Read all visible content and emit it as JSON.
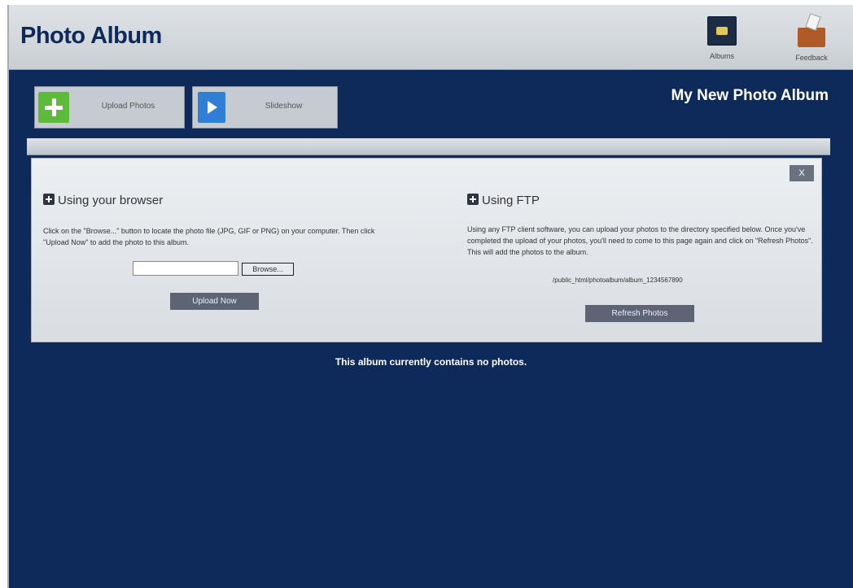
{
  "header": {
    "title": "Photo Album",
    "albums_label": "Albums",
    "feedback_label": "Feedback"
  },
  "toolbar": {
    "upload_label": "Upload Photos",
    "slideshow_label": "Slideshow"
  },
  "album_title": "My New Photo Album",
  "upload_panel": {
    "close_label": "X",
    "browser": {
      "heading": "Using your browser",
      "instructions": "Click on the \"Browse...\" button to locate the photo file (JPG, GIF or PNG) on your computer. Then click \"Upload Now\" to add the photo to this album.",
      "file_value": "",
      "browse_label": "Browse...",
      "upload_now_label": "Upload Now"
    },
    "ftp": {
      "heading": "Using FTP",
      "instructions": "Using any FTP client software, you can upload your photos to the directory specified below. Once you've completed the upload of your photos, you'll need to come to this page again and click on \"Refresh Photos\". This will add the photos to the album.",
      "path": "/public_html/photoalbum/album_1234567890",
      "refresh_label": "Refresh Photos"
    }
  },
  "empty_message": "This album currently contains no photos.",
  "colors": {
    "background": "#0e2a5a",
    "header": "#d4d8dc",
    "button_dark": "#5d6474",
    "upload_green": "#5dbb3a",
    "slideshow_blue": "#2f7fd6"
  }
}
